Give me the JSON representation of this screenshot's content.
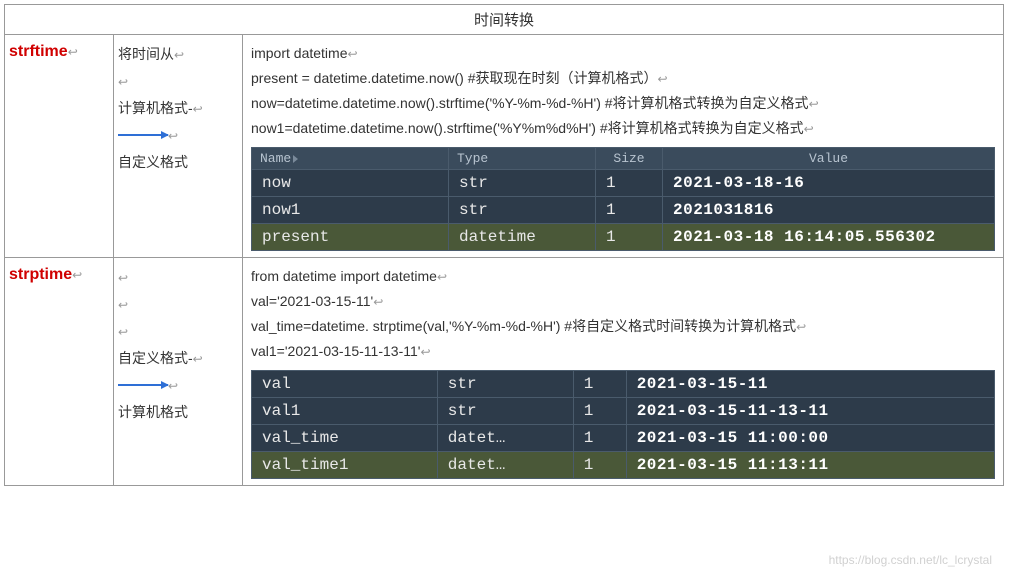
{
  "title": "时间转换",
  "rows": [
    {
      "func": "strftime",
      "desc": [
        "将时间从",
        "",
        "计算机格式-",
        "",
        "自定义格式"
      ],
      "code": [
        "import datetime",
        "present = datetime.datetime.now() #获取现在时刻（计算机格式）",
        "now=datetime.datetime.now().strftime('%Y-%m-%d-%H') #将计算机格式转换为自定义格式",
        "now1=datetime.datetime.now().strftime('%Y%m%d%H') #将计算机格式转换为自定义格式"
      ],
      "var_headers": [
        "Name",
        "Type",
        "Size",
        "Value"
      ],
      "vars": [
        {
          "name": "now",
          "type": "str",
          "size": "1",
          "value": "2021-03-18-16",
          "hl": false
        },
        {
          "name": "now1",
          "type": "str",
          "size": "1",
          "value": "2021031816",
          "hl": false
        },
        {
          "name": "present",
          "type": "datetime",
          "size": "1",
          "value": "2021-03-18 16:14:05.556302",
          "hl": true
        }
      ]
    },
    {
      "func": "strptime",
      "desc": [
        "",
        "",
        "",
        "自定义格式-",
        "",
        "计算机格式"
      ],
      "code": [
        "from datetime import datetime",
        "val='2021-03-15-11'",
        "val_time=datetime. strptime(val,'%Y-%m-%d-%H') #将自定义格式时间转换为计算机格式",
        "val1='2021-03-15-11-13-11'"
      ],
      "var_headers": null,
      "vars": [
        {
          "name": "val",
          "type": "str",
          "size": "1",
          "value": "2021-03-15-11",
          "hl": false
        },
        {
          "name": "val1",
          "type": "str",
          "size": "1",
          "value": "2021-03-15-11-13-11",
          "hl": false
        },
        {
          "name": "val_time",
          "type": "datet…",
          "size": "1",
          "value": "2021-03-15 11:00:00",
          "hl": false
        },
        {
          "name": "val_time1",
          "type": "datet…",
          "size": "1",
          "value": "2021-03-15 11:13:11",
          "hl": true
        }
      ]
    }
  ],
  "watermark": "https://blog.csdn.net/lc_lcrystal"
}
